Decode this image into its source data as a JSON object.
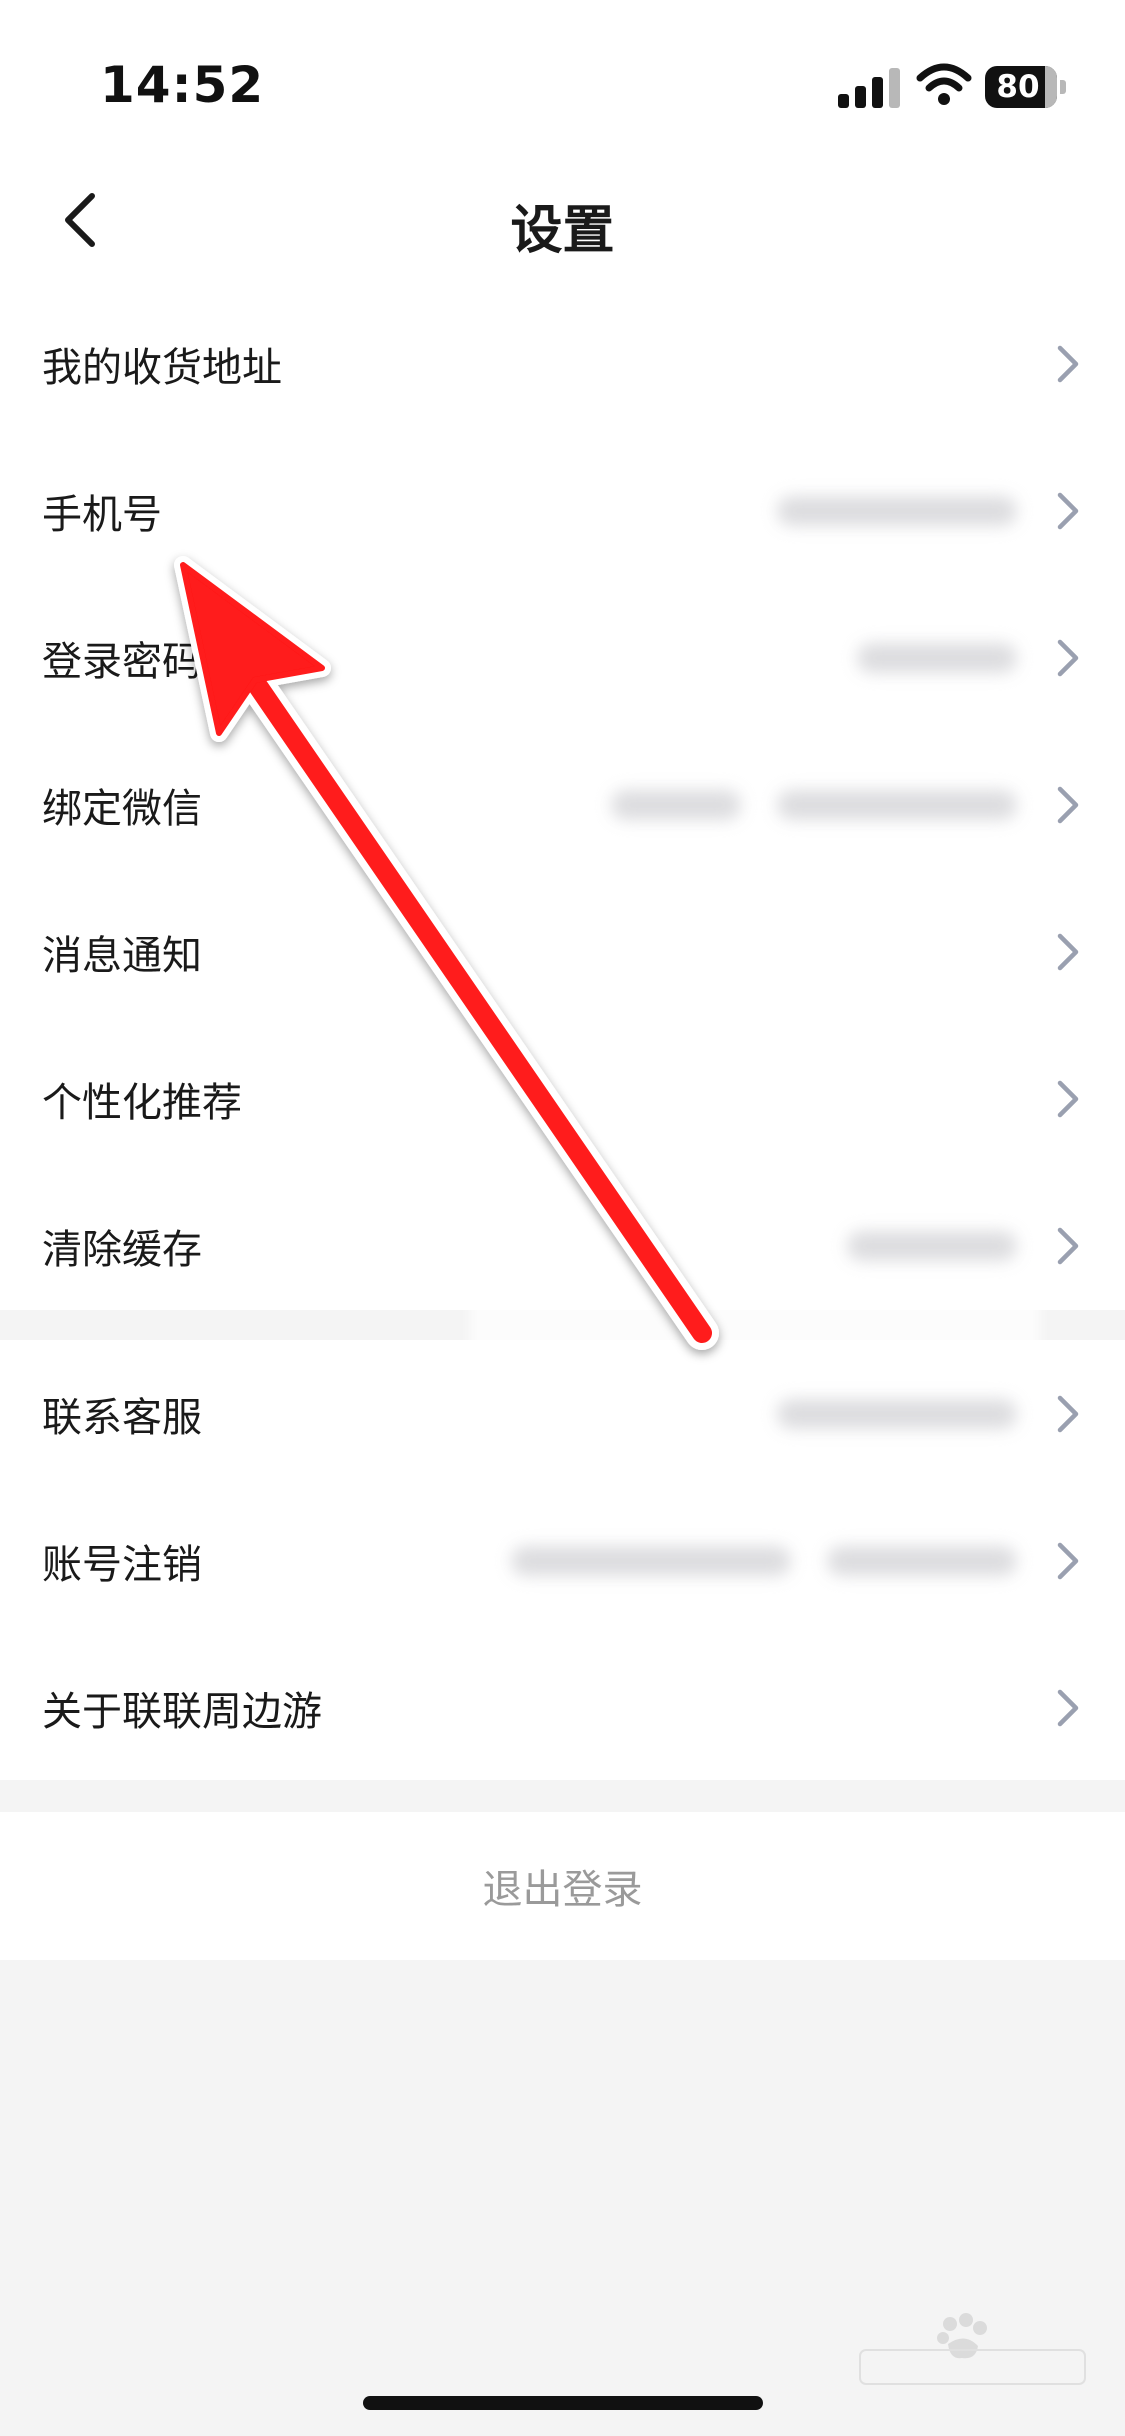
{
  "status_bar": {
    "time": "14:52",
    "battery": "80"
  },
  "nav": {
    "title": "设置"
  },
  "settings": {
    "group1": [
      {
        "label": "我的收货地址"
      },
      {
        "label": "手机号"
      },
      {
        "label": "登录密码"
      },
      {
        "label": "绑定微信"
      },
      {
        "label": "消息通知"
      },
      {
        "label": "个性化推荐"
      },
      {
        "label": "清除缓存"
      }
    ],
    "group2": [
      {
        "label": "联系客服"
      },
      {
        "label": "账号注销"
      },
      {
        "label": "关于联联周边游"
      }
    ]
  },
  "logout": {
    "label": "退出登录"
  },
  "icons": {
    "back": "chevron-left-icon",
    "row_arrow": "chevron-right-icon",
    "signal": "cellular-signal-icon",
    "wifi": "wifi-icon",
    "battery": "battery-icon",
    "annotation": "red-arrow"
  },
  "colors": {
    "annotation": "#ff1a1a",
    "chevron": "#9aa0b0",
    "logout_text": "#9a9a9a",
    "background": "#f4f4f4"
  }
}
